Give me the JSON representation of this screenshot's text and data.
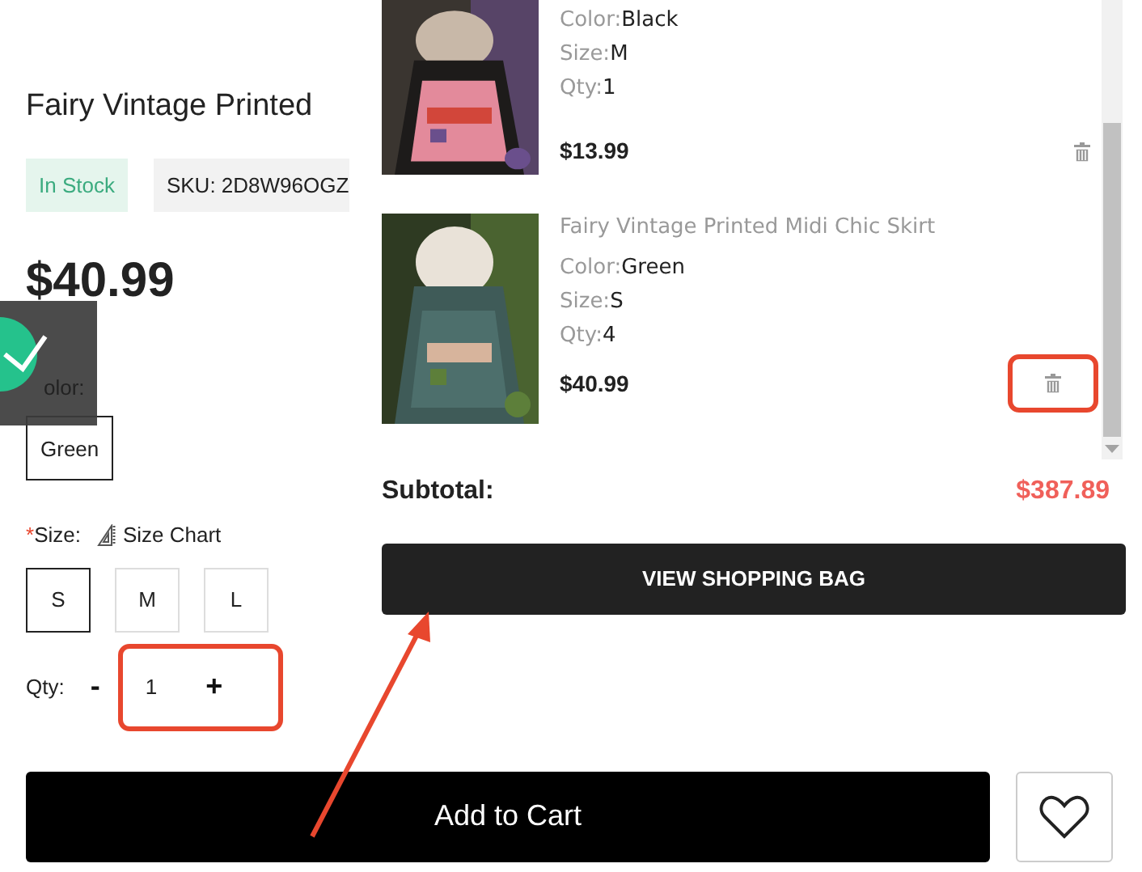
{
  "product": {
    "title": "Fairy Vintage Printed",
    "stock": "In Stock",
    "sku": "SKU: 2D8W96OGZ",
    "price": "$40.99",
    "color_label": "olor:",
    "colors": [
      {
        "label": "Green",
        "selected": true
      }
    ],
    "size_required_mark": "*",
    "size_label": "Size:",
    "size_chart": "Size Chart",
    "sizes": [
      {
        "label": "S",
        "selected": true
      },
      {
        "label": "M",
        "selected": false
      },
      {
        "label": "L",
        "selected": false
      }
    ],
    "qty_label": "Qty:",
    "minus": "-",
    "qty": "1",
    "plus": "+",
    "qty_highlighted": true,
    "add_to_cart": "Add to Cart"
  },
  "toast": {
    "kind": "success"
  },
  "cart": {
    "items": [
      {
        "meta": [
          {
            "label": "Color:",
            "value": "Black"
          },
          {
            "label": "Size:",
            "value": "M"
          },
          {
            "label": "Qty:",
            "value": "1"
          }
        ],
        "price": "$13.99",
        "delete_highlighted": false
      },
      {
        "name": "Fairy Vintage Printed Midi Chic Skirt",
        "meta": [
          {
            "label": "Color:",
            "value": "Green"
          },
          {
            "label": "Size:",
            "value": "S"
          },
          {
            "label": "Qty:",
            "value": "4"
          }
        ],
        "price": "$40.99",
        "delete_highlighted": true
      }
    ],
    "subtotal_label": "Subtotal:",
    "subtotal": "$387.89",
    "view_button": "VIEW SHOPPING BAG"
  }
}
